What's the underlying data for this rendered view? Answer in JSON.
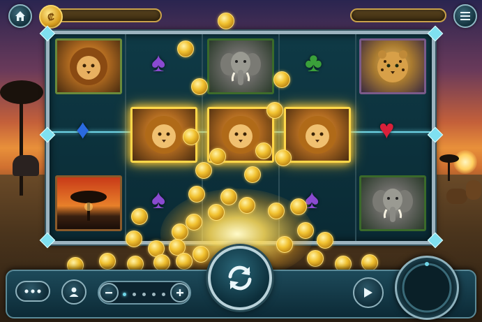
{
  "window": {
    "title": ""
  },
  "top_bar": {
    "home_button": {
      "icon": "home-icon"
    },
    "balance": {
      "coin_symbol": "₡",
      "value": ""
    },
    "win_display": {
      "value": ""
    },
    "menu_button": {
      "icon": "hamburger-menu-icon"
    }
  },
  "reels": {
    "columns": 5,
    "rows": 3,
    "grid": [
      [
        "lion",
        "spade",
        "elephant",
        "club",
        "leopard"
      ],
      [
        "diamond",
        "lion",
        "lion",
        "lion",
        "heart"
      ],
      [
        "acacia-sunset",
        "spade",
        "",
        "spade",
        "elephant"
      ]
    ],
    "winning_line": {
      "row": 2,
      "symbol": "lion",
      "count": 3
    },
    "suit_colors": {
      "spade": "#8a4ad0",
      "club": "#3aa03a",
      "diamond": "#2a6ae0",
      "heart": "#d8203a"
    }
  },
  "bottom_bar": {
    "more_button": {
      "icon": "ellipsis-icon"
    },
    "profile_button": {
      "icon": "user-icon"
    },
    "bet": {
      "minus_icon": "minus-icon",
      "plus_icon": "plus-icon",
      "level": 1,
      "levels": 5
    },
    "spin_button": {
      "icon": "refresh-icon"
    },
    "play_button": {
      "icon": "play-icon"
    },
    "autoplay_dial": {
      "icon": "ring-dial-icon"
    }
  },
  "colors": {
    "accent": "#6fd6e8",
    "gold": "#f2c230",
    "frame": "#9cb3bf"
  }
}
